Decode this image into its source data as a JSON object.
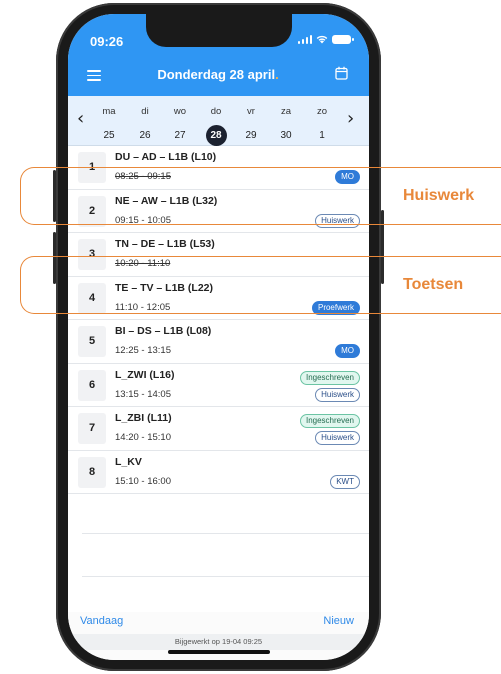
{
  "status": {
    "time": "09:26"
  },
  "header": {
    "title": "Donderdag 28 april",
    "title_dot": "."
  },
  "days": [
    {
      "name": "ma",
      "num": "25"
    },
    {
      "name": "di",
      "num": "26"
    },
    {
      "name": "wo",
      "num": "27"
    },
    {
      "name": "do",
      "num": "28"
    },
    {
      "name": "vr",
      "num": "29"
    },
    {
      "name": "za",
      "num": "30"
    },
    {
      "name": "zo",
      "num": "1"
    }
  ],
  "lessons": [
    {
      "period": "1",
      "title": "DU – AD – L1B (L10)",
      "time": "08:25 - 09:15",
      "badges": [
        "MO"
      ]
    },
    {
      "period": "2",
      "title": "NE – AW – L1B (L32)",
      "time": "09:15 - 10:05",
      "badges": [
        "Huiswerk"
      ]
    },
    {
      "period": "3",
      "title": "TN – DE – L1B (L53)",
      "time": "10:20 - 11:10",
      "badges": []
    },
    {
      "period": "4",
      "title": "TE – TV – L1B (L22)",
      "time": "11:10 - 12:05",
      "badges": [
        "Proefwerk"
      ]
    },
    {
      "period": "5",
      "title": "BI – DS – L1B (L08)",
      "time": "12:25 - 13:15",
      "badges": [
        "MO"
      ]
    },
    {
      "period": "6",
      "title": "L_ZWI (L16)",
      "time": "13:15 - 14:05",
      "badges": [
        "Ingeschreven",
        "Huiswerk"
      ]
    },
    {
      "period": "7",
      "title": "L_ZBI (L11)",
      "time": "14:20 - 15:10",
      "badges": [
        "Ingeschreven",
        "Huiswerk"
      ]
    },
    {
      "period": "8",
      "title": "L_KV",
      "time": "15:10 - 16:00",
      "badges": [
        "KWT"
      ]
    }
  ],
  "footer": {
    "today_label": "Vandaag",
    "new_label": "Nieuw",
    "updated_text": "Bijgewerkt op 19-04 09:25"
  },
  "annotations": {
    "homework_label": "Huiswerk",
    "test_label": "Toetsen"
  },
  "colors": {
    "header_blue": "#2f96f3",
    "accent_orange": "#e8883a",
    "badge_blue": "#2f7bd8",
    "badge_mint": "#e1f7ef"
  }
}
